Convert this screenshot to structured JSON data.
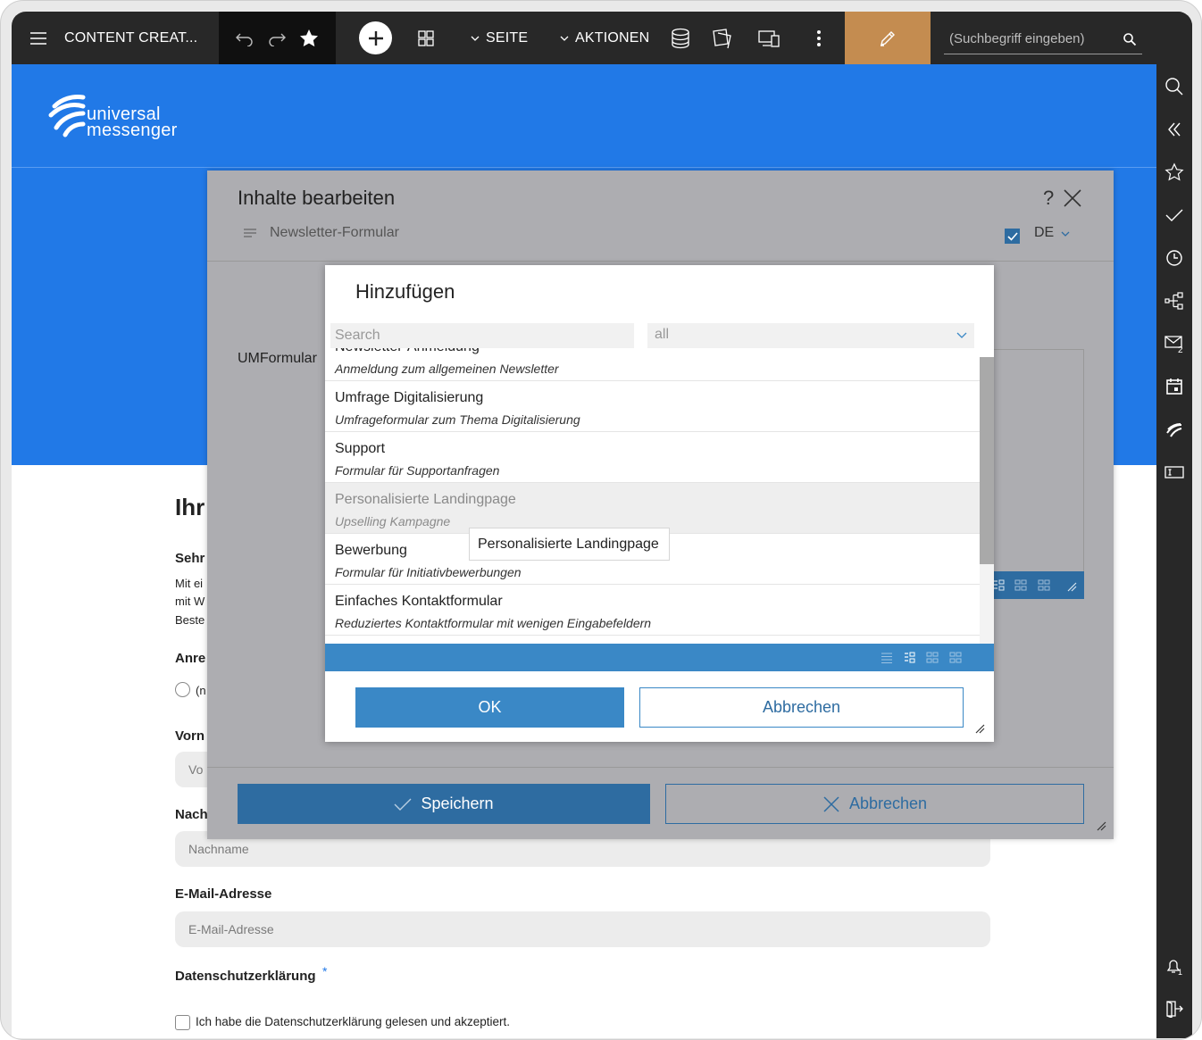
{
  "toolbar": {
    "app_title": "CONTENT CREAT...",
    "seite_label": "SEITE",
    "aktionen_label": "AKTIONEN",
    "search_placeholder": "(Suchbegriff eingeben)"
  },
  "logo": {
    "line1": "universal",
    "line2": "messenger"
  },
  "page": {
    "heading_partial": "Ihr",
    "salutation_partial": "Sehr",
    "body_lines": [
      "Mit ei",
      "mit W",
      "Beste"
    ],
    "anrede_label": "Anre",
    "radio_partial": "(n",
    "vorname_label": "Vorn",
    "vorname_partial": "Vo",
    "nachname_label": "Nach",
    "nachname_placeholder": "Nachname",
    "email_label": "E-Mail-Adresse",
    "email_placeholder": "E-Mail-Adresse",
    "privacy_label": "Datenschutzerklärung",
    "required_mark": "*",
    "privacy_checkbox_text": "Ich habe die Datenschutzerklärung gelesen und akzeptiert."
  },
  "edit_dialog": {
    "title": "Inhalte bearbeiten",
    "help": "?",
    "element_name": "Newsletter-Formular",
    "language": "DE",
    "field_label": "UMFormular",
    "save_label": "Speichern",
    "cancel_label": "Abbrechen"
  },
  "add_dialog": {
    "title": "Hinzufügen",
    "search_placeholder": "Search",
    "filter_value": "all",
    "items": [
      {
        "title": "Newsletter-Anmeldung",
        "subtitle": "Anmeldung zum allgemeinen Newsletter"
      },
      {
        "title": "Umfrage Digitalisierung",
        "subtitle": "Umfrageformular zum Thema Digitalisierung"
      },
      {
        "title": "Support",
        "subtitle": "Formular für Supportanfragen"
      },
      {
        "title": "Personalisierte Landingpage",
        "subtitle": "Upselling Kampagne"
      },
      {
        "title": "Bewerbung",
        "subtitle": "Formular für Initiativbewerbungen"
      },
      {
        "title": "Einfaches Kontaktformular",
        "subtitle": "Reduziertes Kontaktformular mit wenigen Eingabefeldern"
      }
    ],
    "ok_label": "OK",
    "cancel_label": "Abbrechen",
    "tooltip": "Personalisierte Landingpage"
  },
  "colors": {
    "toolbar_bg": "#282828",
    "accent_blue": "#2179e7",
    "button_blue": "#3a88c6",
    "pencil_bg": "#c48c50"
  }
}
